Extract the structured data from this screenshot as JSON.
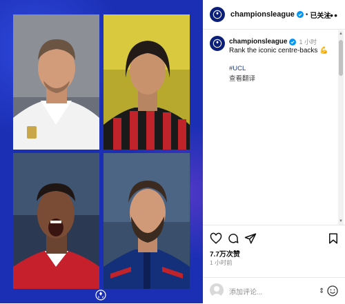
{
  "post": {
    "username": "championsleague",
    "follow_status": "已关注",
    "time_ago": "1 小时",
    "caption": "Rank the iconic centre-backs 💪",
    "hashtag": "#UCL",
    "translate_label": "查看翻译",
    "likes": "7.7万次赞",
    "posted_time": "1 小时前",
    "comment_placeholder": "添加评论..."
  },
  "icons": {
    "like": "heart-icon",
    "comment": "comment-icon",
    "share": "send-icon",
    "save": "bookmark-icon",
    "more": "more-icon",
    "verified": "verified-badge-icon",
    "emoji": "emoji-icon"
  },
  "colors": {
    "media_bg": "#1b2fb4",
    "accent_blue": "#0095f6",
    "text": "#111111",
    "muted": "#8e8e8e"
  }
}
